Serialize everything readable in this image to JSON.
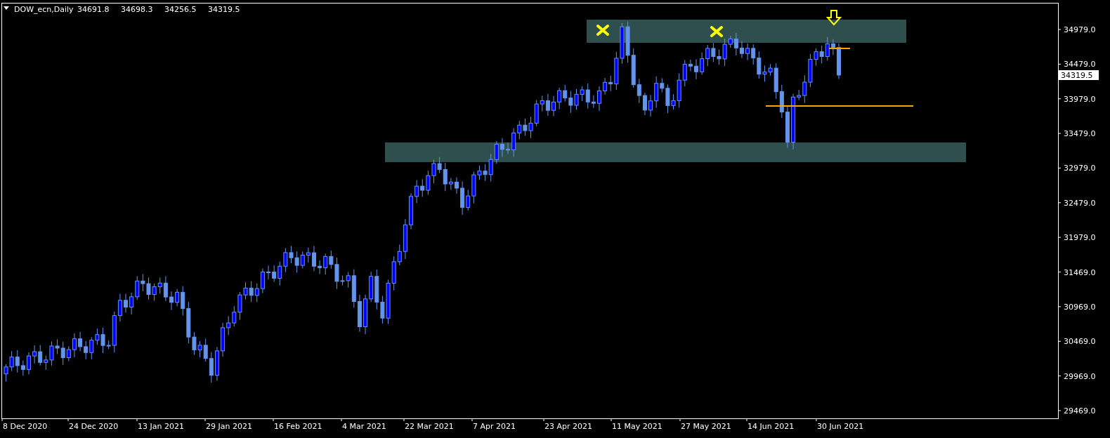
{
  "chart": {
    "symbol": "DOW_ecn,Daily",
    "ohlc": [
      "34691.8",
      "34698.3",
      "34256.5",
      "34319.5"
    ],
    "current_price": "34319.5",
    "price_axis": [
      "34979.0",
      "34479.0",
      "33979.0",
      "33479.0",
      "32979.0",
      "32479.0",
      "31979.0",
      "31469.0",
      "30969.0",
      "30469.0",
      "29969.0",
      "29469.0"
    ],
    "time_axis": [
      "8 Dec 2020",
      "24 Dec 2020",
      "13 Jan 2021",
      "29 Jan 2021",
      "16 Feb 2021",
      "4 Mar 2021",
      "22 Mar 2021",
      "7 Apr 2021",
      "23 Apr 2021",
      "11 May 2021",
      "27 May 2021",
      "14 Jun 2021",
      "30 Jun 2021"
    ]
  }
}
